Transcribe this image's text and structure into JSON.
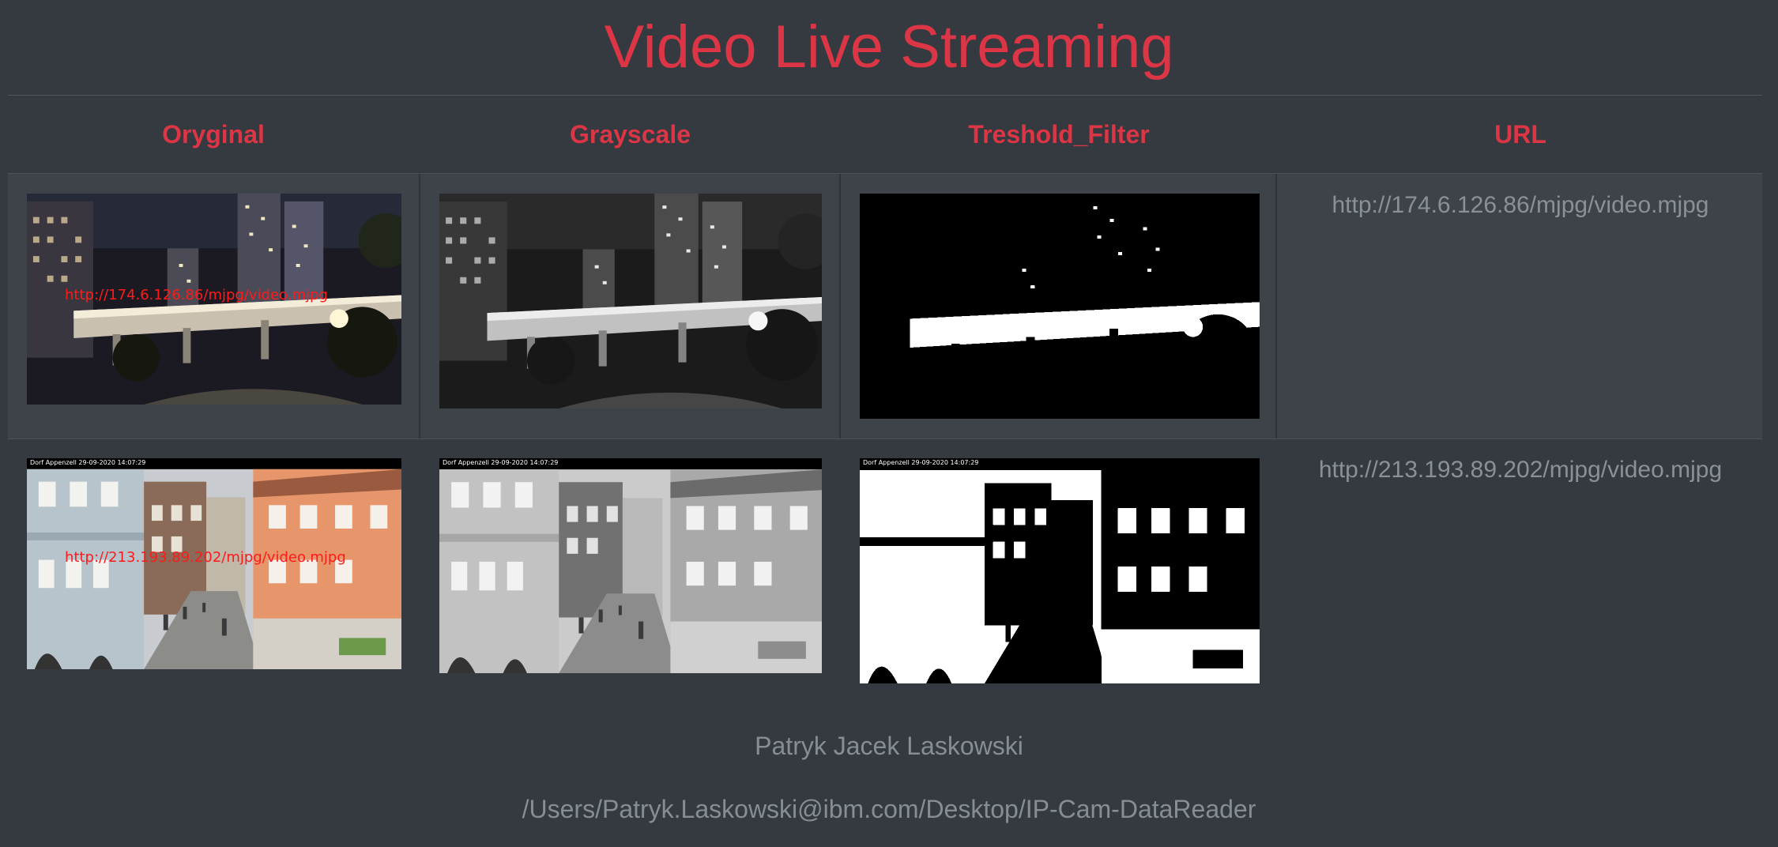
{
  "page": {
    "title": "Video Live Streaming"
  },
  "table": {
    "headers": [
      "Oryginal",
      "Grayscale",
      "Treshold_Filter",
      "URL"
    ],
    "rows": [
      {
        "overlay_text": "http://174.6.126.86/mjpg/video.mjpg",
        "url": "http://174.6.126.86/mjpg/video.mjpg",
        "scene": "night-city-bridge"
      },
      {
        "overlay_text": "http://213.193.89.202/mjpg/video.mjpg",
        "url": "http://213.193.89.202/mjpg/video.mjpg",
        "camera_timestamp": "Dorf Appenzell 29-09-2020 14:07:29",
        "scene": "street-appenzell"
      }
    ]
  },
  "footer": {
    "author": "Patryk Jacek Laskowski",
    "path": "/Users/Patryk.Laskowski@ibm.com/Desktop/IP-Cam-DataReader"
  },
  "colors": {
    "background": "#343a40",
    "accent": "#dc3545",
    "row_highlight": "#3d4349",
    "muted_text": "#8a9097"
  }
}
